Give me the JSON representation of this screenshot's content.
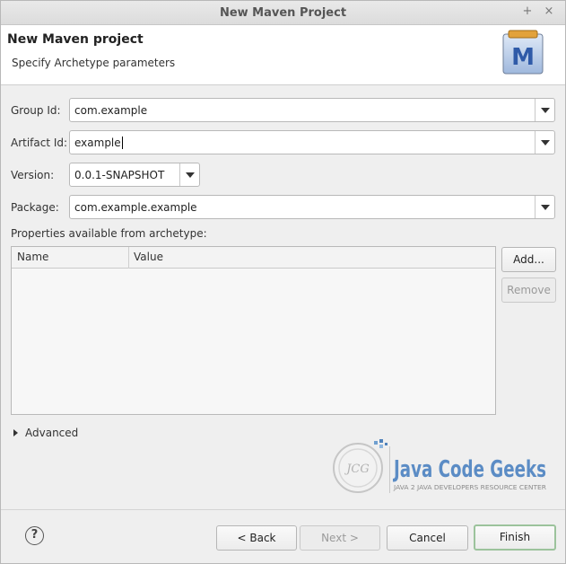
{
  "window": {
    "title": "New Maven Project",
    "pin_glyph": "+",
    "close_glyph": "×"
  },
  "banner": {
    "title": "New Maven project",
    "subtitle": "Specify Archetype parameters",
    "logo_icon": "maven-m-icon",
    "logo_letter": "M"
  },
  "form": {
    "group_id": {
      "label": "Group Id:",
      "value": "com.example"
    },
    "artifact_id": {
      "label": "Artifact Id:",
      "value": "example"
    },
    "version": {
      "label": "Version:",
      "value": "0.0.1-SNAPSHOT"
    },
    "package": {
      "label": "Package:",
      "value": "com.example.example"
    }
  },
  "properties": {
    "label": "Properties available from archetype:",
    "columns": [
      "Name",
      "Value"
    ],
    "rows": [],
    "add_label": "Add...",
    "remove_label": "Remove"
  },
  "advanced": {
    "label": "Advanced"
  },
  "watermark": {
    "brand": "Java Code Geeks",
    "tagline": "JAVA 2 JAVA DEVELOPERS RESOURCE CENTER",
    "badge": "JCG"
  },
  "footer": {
    "help_glyph": "?",
    "back_label": "< Back",
    "next_label": "Next >",
    "cancel_label": "Cancel",
    "finish_label": "Finish"
  },
  "colors": {
    "finish_border": "#9cc39c",
    "maven_blue": "#2f5aa8"
  }
}
